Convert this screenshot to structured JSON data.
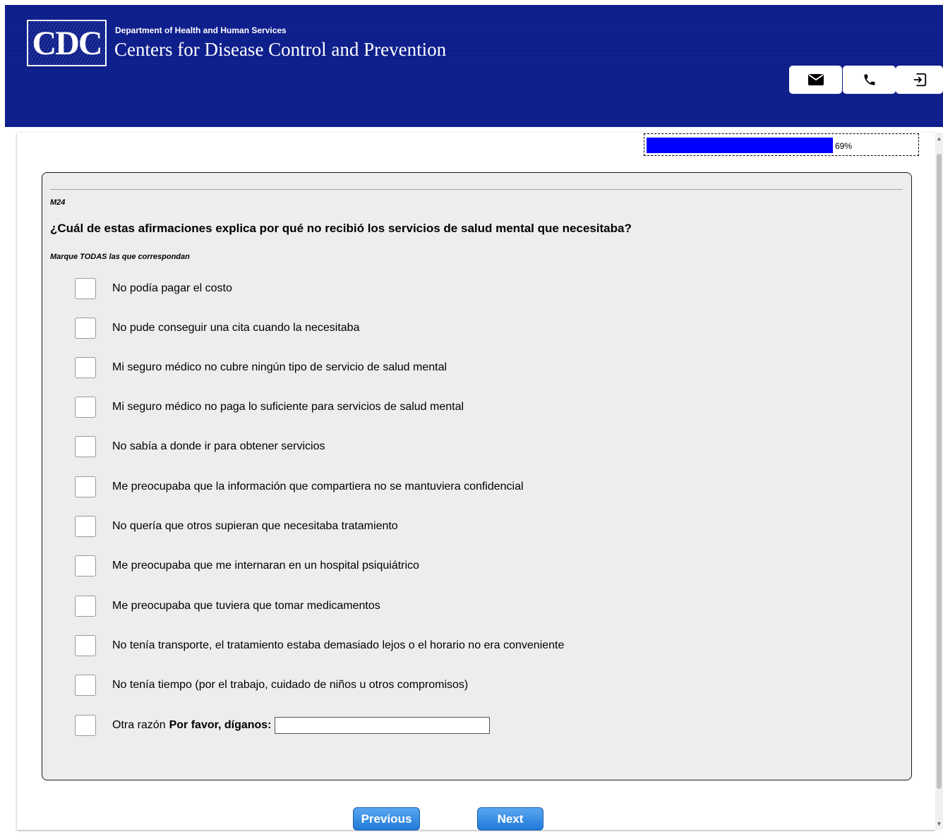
{
  "header": {
    "logo_text": "CDC",
    "department": "Department of Health and Human Services",
    "agency": "Centers for Disease Control and Prevention",
    "icons": [
      "mail-icon",
      "phone-icon",
      "exit-icon"
    ],
    "background_color": "#0a1b8a"
  },
  "progress": {
    "label": "69%",
    "value": 0.69,
    "fill_color": "#0000ff"
  },
  "question": {
    "id": "M24",
    "text": "¿Cuál de estas afirmaciones explica por qué no recibió los servicios de salud mental que necesitaba?",
    "instruction": "Marque TODAS las que correspondan",
    "options": [
      "No podía pagar el costo",
      "No pude conseguir una cita cuando la necesitaba",
      "Mi seguro médico no cubre ningún tipo de servicio de salud mental",
      "Mi seguro médico no paga lo suficiente para servicios de salud mental",
      "No sabía a donde ir para obtener servicios",
      "Me preocupaba que la información que compartiera no se mantuviera confidencial",
      "No quería que otros supieran que necesitaba tratamiento",
      "Me preocupaba que me internaran en un hospital psiquiátrico",
      "Me preocupaba que tuviera que tomar medicamentos",
      "No tenía transporte, el tratamiento estaba demasiado lejos o el horario no era conveniente",
      "No tenía tiempo (por el trabajo, cuidado de niños u otros compromisos)"
    ],
    "other_label": "Otra razón",
    "other_prompt": "Por favor, díganos:",
    "other_value": ""
  },
  "nav": {
    "previous_label": "Previous",
    "next_label": "Next",
    "button_color": "#2f86e0"
  }
}
